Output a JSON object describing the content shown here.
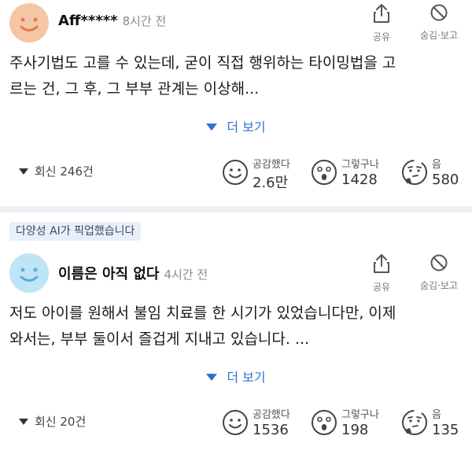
{
  "comments": [
    {
      "username": "Aff*****",
      "time": "8시간 전",
      "share_label": "공유",
      "hide_label": "숨김·보고",
      "text_lines": [
        "주사기법도 고를 수 있는데, 굳이 직접 행위하는 타이밍법을 고",
        "르는 건, 그 후, 그 부부 관계는 이상해..."
      ],
      "more_label": "더 보기",
      "replies_label": "회신 246건",
      "reactions": [
        {
          "label": "공감했다",
          "count": "2.6만",
          "icon": "smile-face-icon"
        },
        {
          "label": "그렇구나",
          "count": "1428",
          "icon": "surprised-face-icon"
        },
        {
          "label": "음",
          "count": "580",
          "icon": "thinking-face-icon"
        }
      ],
      "avatar_color": "#f5c6a6"
    },
    {
      "ai_badge": "다양성 AI가 픽업했습니다",
      "username": "이름은 아직 없다",
      "time": "4시간 전",
      "share_label": "공유",
      "hide_label": "숨김·보고",
      "text_lines": [
        "저도 아이를 원해서 불임 치료를 한 시기가 있었습니다만, 이제",
        "와서는, 부부 둘이서 즐겁게 지내고 있습니다. ..."
      ],
      "more_label": "더 보기",
      "replies_label": "회신 20건",
      "reactions": [
        {
          "label": "공감했다",
          "count": "1536",
          "icon": "smile-face-icon"
        },
        {
          "label": "그렇구나",
          "count": "198",
          "icon": "surprised-face-icon"
        },
        {
          "label": "음",
          "count": "135",
          "icon": "thinking-face-icon"
        }
      ],
      "avatar_color": "#bfe4f5"
    }
  ],
  "colors": {
    "link": "#2f6fd6",
    "divider": "#eef0f3",
    "badge_bg": "#e9eff8"
  }
}
